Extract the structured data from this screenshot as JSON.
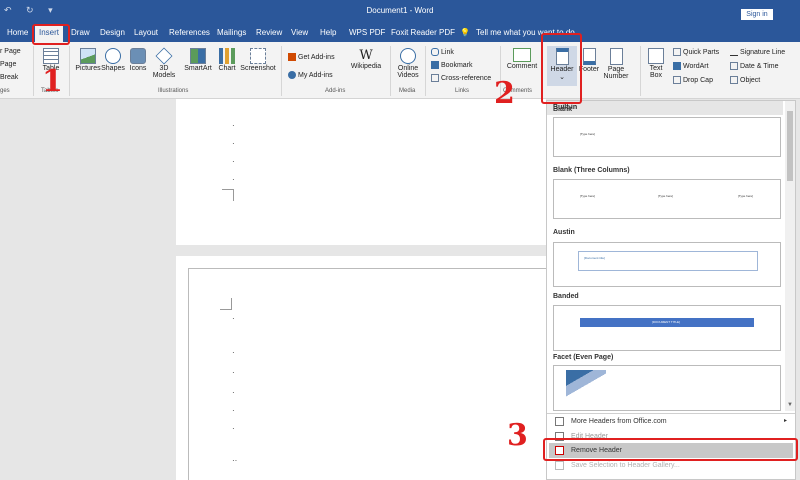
{
  "titlebar": {
    "title": "Document1 - Word",
    "quick_access": "↶ ↻ ▾",
    "sign_in": "Sign in"
  },
  "tabs": [
    "Home",
    "Insert",
    "Draw",
    "Design",
    "Layout",
    "References",
    "Mailings",
    "Review",
    "View",
    "Help",
    "WPS PDF",
    "Foxit Reader PDF"
  ],
  "tell_me": "Tell me what you want to do",
  "ribbon": {
    "pages_items": [
      "r Page",
      "Page",
      "Break"
    ],
    "pages_label": "ges",
    "table": "Table",
    "tables_label": "Tables",
    "illustrations": [
      "Pictures",
      "Shapes",
      "Icons",
      "3D",
      "Models",
      "SmartArt",
      "Chart",
      "Screenshot"
    ],
    "illustrations_label": "Illustrations",
    "addins": [
      "Get Add-ins",
      "My Add-ins",
      "Wikipedia"
    ],
    "addins_label": "Add-ins",
    "media": [
      "Online",
      "Videos"
    ],
    "media_label": "Media",
    "links": [
      "Link",
      "Bookmark",
      "Cross-reference"
    ],
    "links_label": "Links",
    "comment": "Comment",
    "comments_label": "Comments",
    "header": "Header",
    "footer": "Footer",
    "page_number": [
      "Page",
      "Number"
    ],
    "text": [
      "Text",
      "Box"
    ],
    "text_tools": [
      "Quick Parts",
      "WordArt",
      "Drop Cap"
    ],
    "text_tools2": [
      "Signature Line",
      "Date & Time",
      "Object"
    ]
  },
  "gallery": {
    "section": "Built-in",
    "items": [
      {
        "name": "Blank",
        "sample": "[Type here]"
      },
      {
        "name": "Blank (Three Columns)",
        "sample": "[Type here]"
      },
      {
        "name": "Austin",
        "sample": "[Document title]"
      },
      {
        "name": "Banded",
        "sample": "[DOCUMENT TITLE]"
      },
      {
        "name": "Facet (Even Page)",
        "sample": ""
      }
    ],
    "more": "More Headers from Office.com",
    "edit": "Edit Header",
    "remove": "Remove Header",
    "save": "Save Selection to Header Gallery..."
  },
  "annotations": {
    "step1": "1",
    "step2": "2",
    "step3": "3"
  },
  "colors": {
    "accent": "#2b579a",
    "annotation": "#e02020"
  }
}
